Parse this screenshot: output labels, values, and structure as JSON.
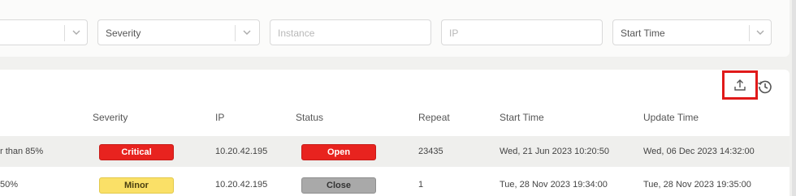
{
  "filters": {
    "first_value": "",
    "severity_label": "Severity",
    "instance_placeholder": "Instance",
    "ip_placeholder": "IP",
    "start_time_label": "Start Time"
  },
  "toolbar": {
    "export_icon": "upload-icon",
    "history_icon": "history-icon",
    "highlight_color": "#e01a1a"
  },
  "table": {
    "headers": {
      "severity": "Severity",
      "ip": "IP",
      "status": "Status",
      "repeat": "Repeat",
      "start_time": "Start Time",
      "update_time": "Update Time"
    },
    "rows": [
      {
        "description": "r than 85%",
        "severity": "Critical",
        "ip": "10.20.42.195",
        "status": "Open",
        "repeat": "23435",
        "start_time": "Wed, 21 Jun 2023 10:20:50",
        "update_time": "Wed, 06 Dec 2023 14:32:00"
      },
      {
        "description": "50%",
        "severity": "Minor",
        "ip": "10.20.42.195",
        "status": "Close",
        "repeat": "1",
        "start_time": "Tue, 28 Nov 2023 19:34:00",
        "update_time": "Tue, 28 Nov 2023 19:35:00"
      }
    ]
  },
  "colors": {
    "critical": "#e8231f",
    "minor": "#fae067",
    "open": "#e8231f",
    "close": "#a9a9a9"
  }
}
